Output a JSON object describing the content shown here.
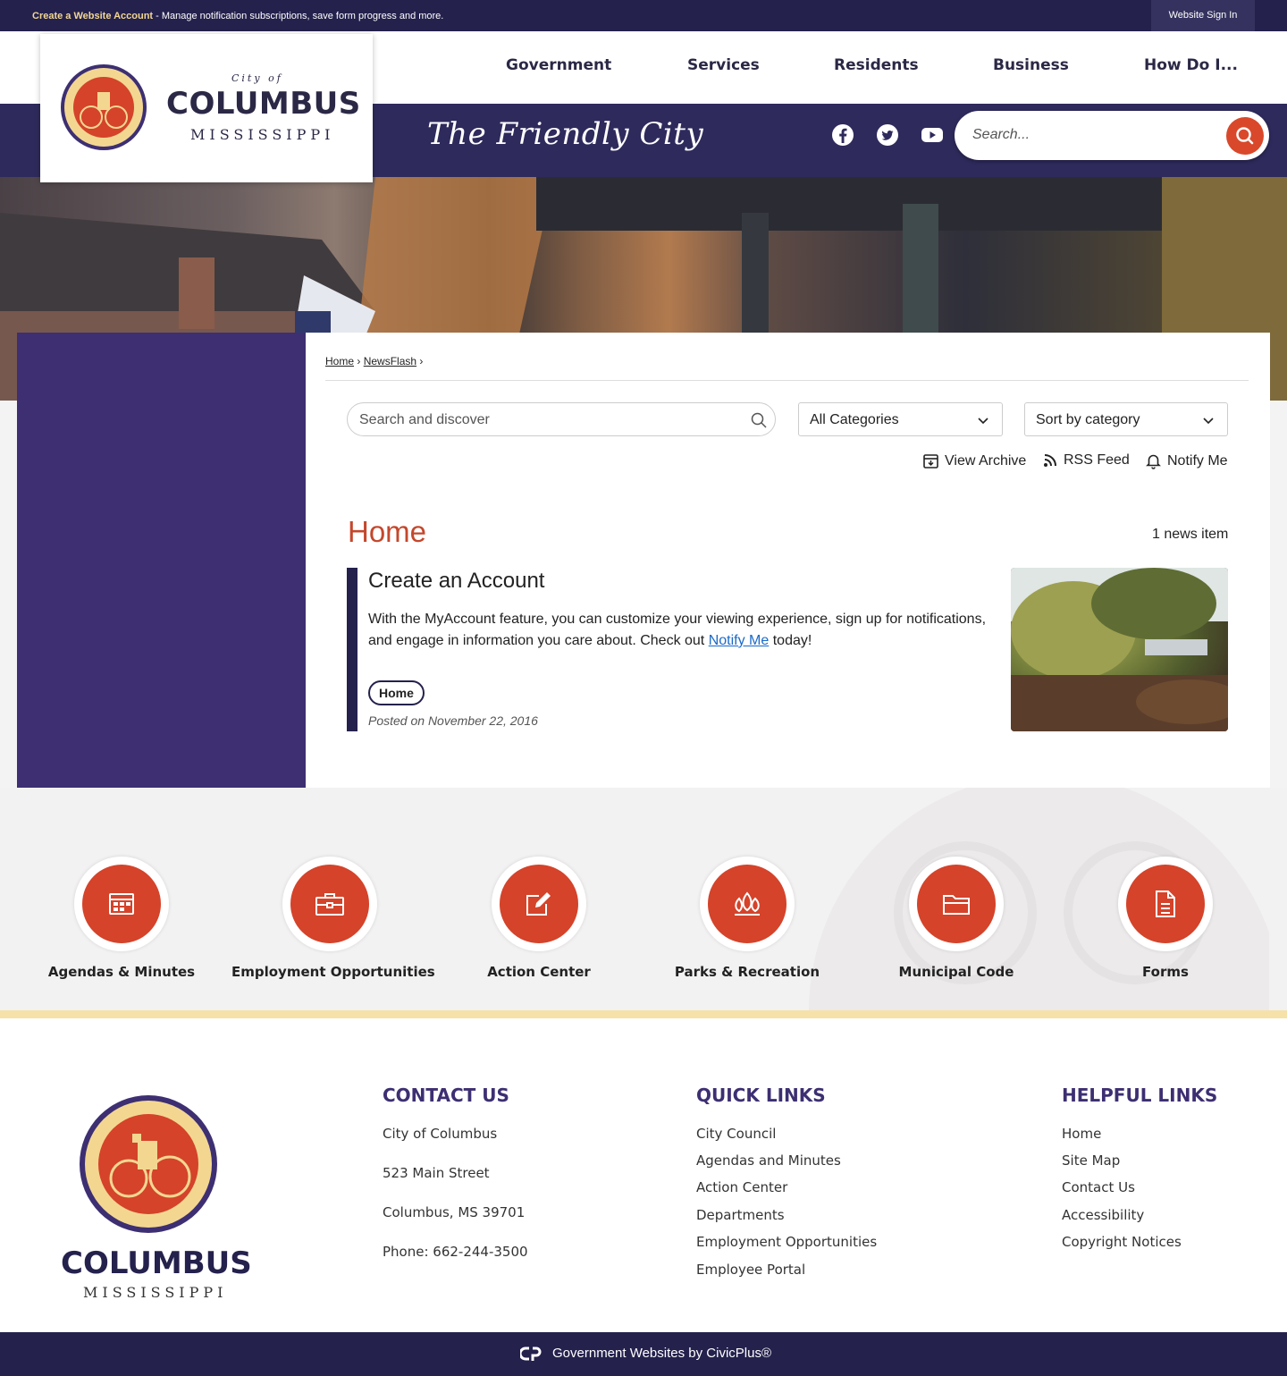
{
  "topbar": {
    "create_bold": "Create a Website Account",
    "create_rest": " - Manage notification subscriptions, save form progress and more.",
    "signin": "Website Sign In"
  },
  "logo": {
    "city_of": "City of",
    "name": "COLUMBUS",
    "state": "MISSISSIPPI"
  },
  "nav": [
    "Government",
    "Services",
    "Residents",
    "Business",
    "How Do I..."
  ],
  "tagline": "The Friendly City",
  "social": [
    "facebook-icon",
    "twitter-icon",
    "youtube-icon"
  ],
  "search": {
    "placeholder": "Search..."
  },
  "breadcrumb": {
    "home": "Home",
    "newsflash": "NewsFlash"
  },
  "newsflash": {
    "search_placeholder": "Search and discover",
    "categories": "All Categories",
    "sort": "Sort by category",
    "view_archive": "View Archive",
    "rss": "RSS Feed",
    "notify": "Notify Me",
    "heading": "Home",
    "count": "1 news item"
  },
  "item": {
    "title": "Create an Account",
    "body_before": "With the MyAccount feature, you can customize your viewing experience, sign up for notifications, and engage in information you care about. Check out ",
    "link": "Notify Me",
    "body_after": " today!",
    "tag": "Home",
    "posted": "Posted on November 22, 2016"
  },
  "quick_links": [
    {
      "label": "Agendas & Minutes",
      "icon": "calendar-icon"
    },
    {
      "label": "Employment Opportunities",
      "icon": "briefcase-icon"
    },
    {
      "label": "Action Center",
      "icon": "edit-icon"
    },
    {
      "label": "Parks & Recreation",
      "icon": "trees-icon"
    },
    {
      "label": "Municipal Code",
      "icon": "folder-icon"
    },
    {
      "label": "Forms",
      "icon": "document-icon"
    }
  ],
  "footer": {
    "logo_name": "COLUMBUS",
    "logo_state": "MISSISSIPPI",
    "contact": {
      "heading": "CONTACT US",
      "lines": [
        "City of Columbus",
        "523 Main Street",
        "Columbus, MS 39701",
        "Phone: 662-244-3500"
      ]
    },
    "quick": {
      "heading": "QUICK LINKS",
      "links": [
        "City Council",
        "Agendas and Minutes",
        "Action Center",
        "Departments",
        "Employment Opportunities",
        "Employee Portal"
      ]
    },
    "helpful": {
      "heading": "HELPFUL LINKS",
      "links": [
        "Home",
        "Site Map",
        "Contact Us",
        "Accessibility",
        "Copyright Notices"
      ]
    }
  },
  "bottom": {
    "text": "Government Websites by CivicPlus®"
  },
  "colors": {
    "navy": "#24214d",
    "purple": "#3d2f72",
    "accent": "#d4432a",
    "gold": "#f6e2a8"
  }
}
